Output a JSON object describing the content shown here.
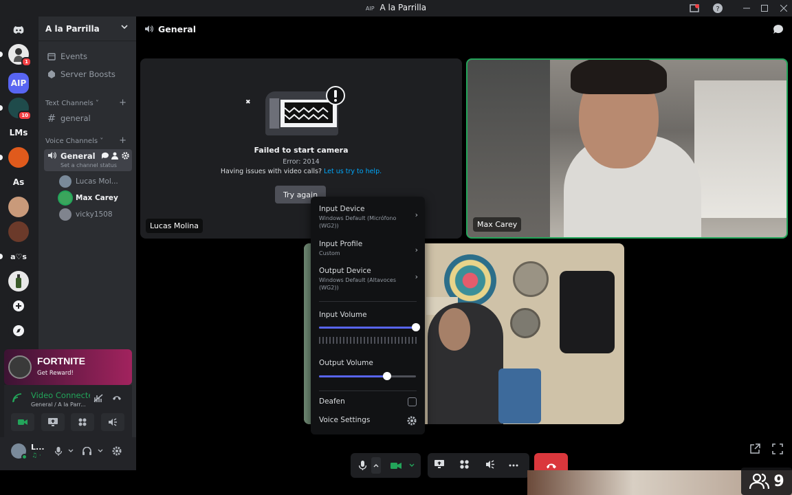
{
  "titlebar": {
    "tag": "AIP",
    "title": "A la Parrilla"
  },
  "servers": [
    {
      "name": "server-1",
      "badge": "1"
    },
    {
      "name": "AIP",
      "label": "AIP"
    },
    {
      "name": "server-3",
      "badge": "10"
    },
    {
      "name": "LMs",
      "label": "LMs"
    },
    {
      "name": "server-5"
    },
    {
      "name": "As",
      "label": "As"
    },
    {
      "name": "server-7"
    },
    {
      "name": "server-8"
    },
    {
      "name": "a♡s",
      "label": "a♡s"
    },
    {
      "name": "server-10"
    }
  ],
  "sidebar": {
    "server_name": "A la Parrilla",
    "events": "Events",
    "boosts": "Server Boosts",
    "text_category": "Text Channels",
    "text_channel": "general",
    "voice_category": "Voice Channels",
    "voice_channel": "General",
    "voice_status": "Set a channel status",
    "voice_users": [
      "Lucas Mol...",
      "Max Carey",
      "vicky1508"
    ]
  },
  "promo": {
    "title": "FORTNITE",
    "subtitle": "Get Reward!"
  },
  "voice_panel": {
    "status": "Video Connecte",
    "location": "General / A la Parr..."
  },
  "user_panel": {
    "name": "L..."
  },
  "main": {
    "channel": "General",
    "error_title": "Failed to start camera",
    "error_code": "Error: 2014",
    "help_text": "Having issues with video calls?",
    "help_link": "Let us try to help.",
    "try_again": "Try again",
    "tile_left_name": "Lucas Molina",
    "tile_right_name": "Max Carey"
  },
  "audio_menu": {
    "input_device_title": "Input Device",
    "input_device_value": "Windows Default (Micrófono (WG2))",
    "input_profile_title": "Input Profile",
    "input_profile_value": "Custom",
    "output_device_title": "Output Device",
    "output_device_value": "Windows Default (Altavoces (WG2))",
    "input_volume_label": "Input Volume",
    "input_volume": 1.0,
    "output_volume_label": "Output Volume",
    "output_volume": 0.7,
    "deafen_label": "Deafen",
    "deafen_checked": false,
    "voice_settings_label": "Voice Settings"
  },
  "corner_count": "9",
  "colors": {
    "accent": "#5865f2",
    "green": "#23a55a",
    "red": "#da373c"
  }
}
